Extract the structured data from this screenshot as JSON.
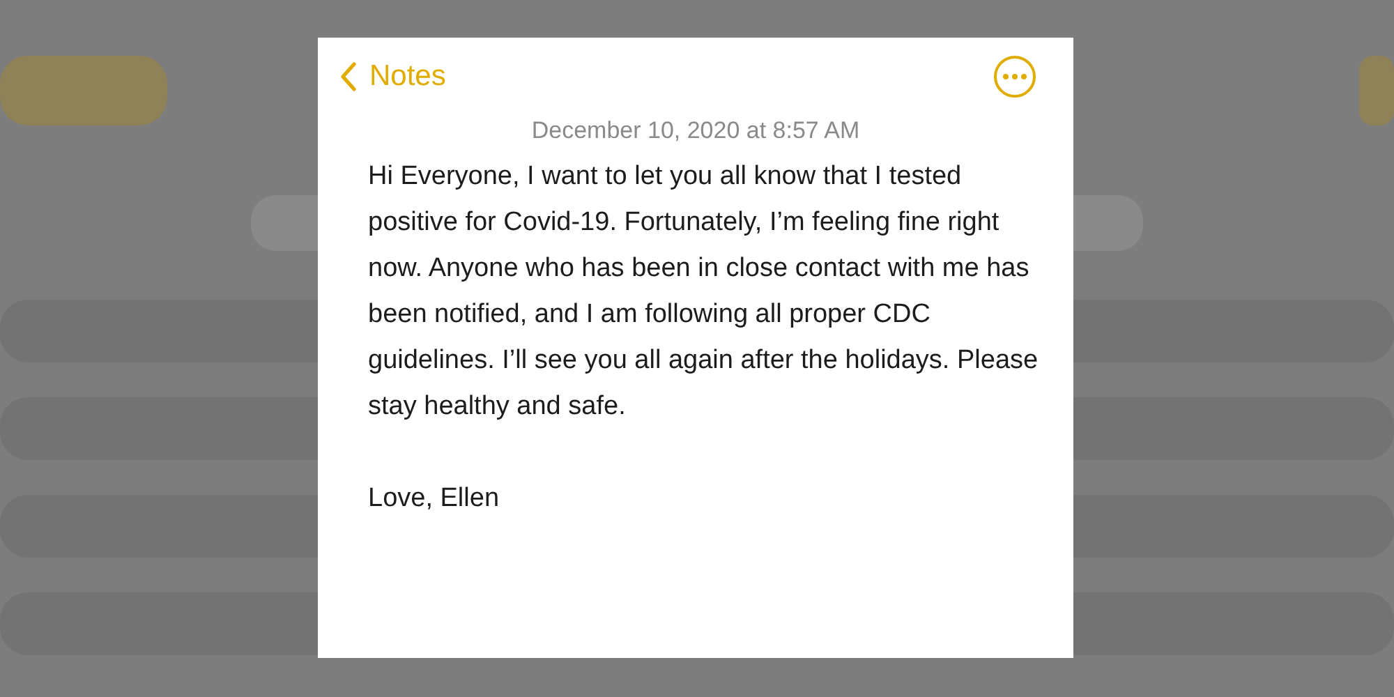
{
  "note": {
    "back_label": "Notes",
    "date": "December 10, 2020 at 8:57 AM",
    "paragraphs": [
      "Hi Everyone, I want to let you all know that I tested positive for Covid-19. Fortunately, I’m feeling fine right now. Anyone who has been in close contact with me has been notified, and I am following all proper CDC guidelines. I’ll see you all again after the holidays. Please stay healthy and safe.",
      "Love, Ellen"
    ]
  }
}
